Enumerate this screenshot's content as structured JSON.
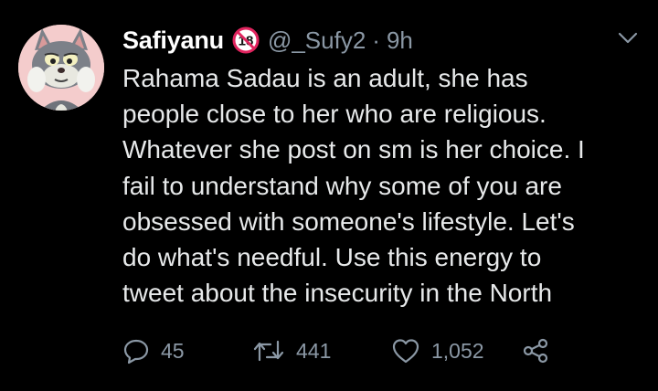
{
  "tweet": {
    "display_name": "Safiyanu",
    "age_badge": "18",
    "handle": "@_Sufy2",
    "separator": "·",
    "time": "9h",
    "body_lines": [
      "Rahama Sadau is an adult, she has",
      "people close to her who are religious.",
      "Whatever she post on sm is her choice. I",
      "fail to understand why some of you are",
      "obsessed with someone's lifestyle. Let's",
      "do what's needful. Use this energy to",
      "tweet about the insecurity in the North"
    ],
    "replies": "45",
    "retweets": "441",
    "likes": "1,052"
  },
  "icons": {
    "avatar": "cartoon-cat-avatar",
    "badge": "no-under-18-icon",
    "menu": "chevron-down-icon",
    "reply": "reply-icon",
    "retweet": "retweet-icon",
    "like": "heart-icon",
    "share": "share-icon"
  },
  "colors": {
    "background": "#000000",
    "text": "#e7e9ea",
    "secondary": "#8b98a5",
    "badge_red": "#e0245e"
  }
}
